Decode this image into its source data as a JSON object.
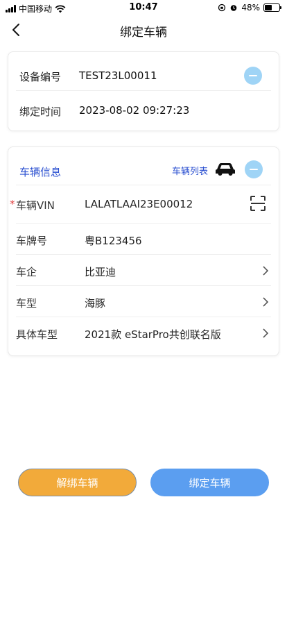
{
  "status_bar": {
    "carrier": "中国移动",
    "time": "10:47",
    "battery": "48%",
    "battery_level": 0.48
  },
  "nav": {
    "title": "绑定车辆",
    "back_icon": "chevron-left-icon"
  },
  "device": {
    "id_label": "设备编号",
    "id_value": "TEST23L00011",
    "time_label": "绑定时间",
    "time_value": "2023-08-02 09:27:23"
  },
  "vehicle": {
    "section_title": "车辆信息",
    "list_link": "车辆列表",
    "required_mark": "*",
    "fields": [
      {
        "label": "车辆VIN",
        "value": "LALATLAAI23E00012"
      },
      {
        "label": "车牌号",
        "value": "粤B123456"
      },
      {
        "label": "车企",
        "value": "比亚迪"
      },
      {
        "label": "车型",
        "value": "海豚"
      },
      {
        "label": "具体车型",
        "value": "2021款 eStarPro共创联名版"
      }
    ]
  },
  "buttons": {
    "unbind": "解绑车辆",
    "bind": "绑定车辆"
  },
  "colors": {
    "accent_blue": "#2a4fd0",
    "collapse_bubble": "#9fd4f6",
    "unbind_orange": "#f2aa3a",
    "bind_blue": "#5b9ef0",
    "required_red": "#e03b3b"
  }
}
